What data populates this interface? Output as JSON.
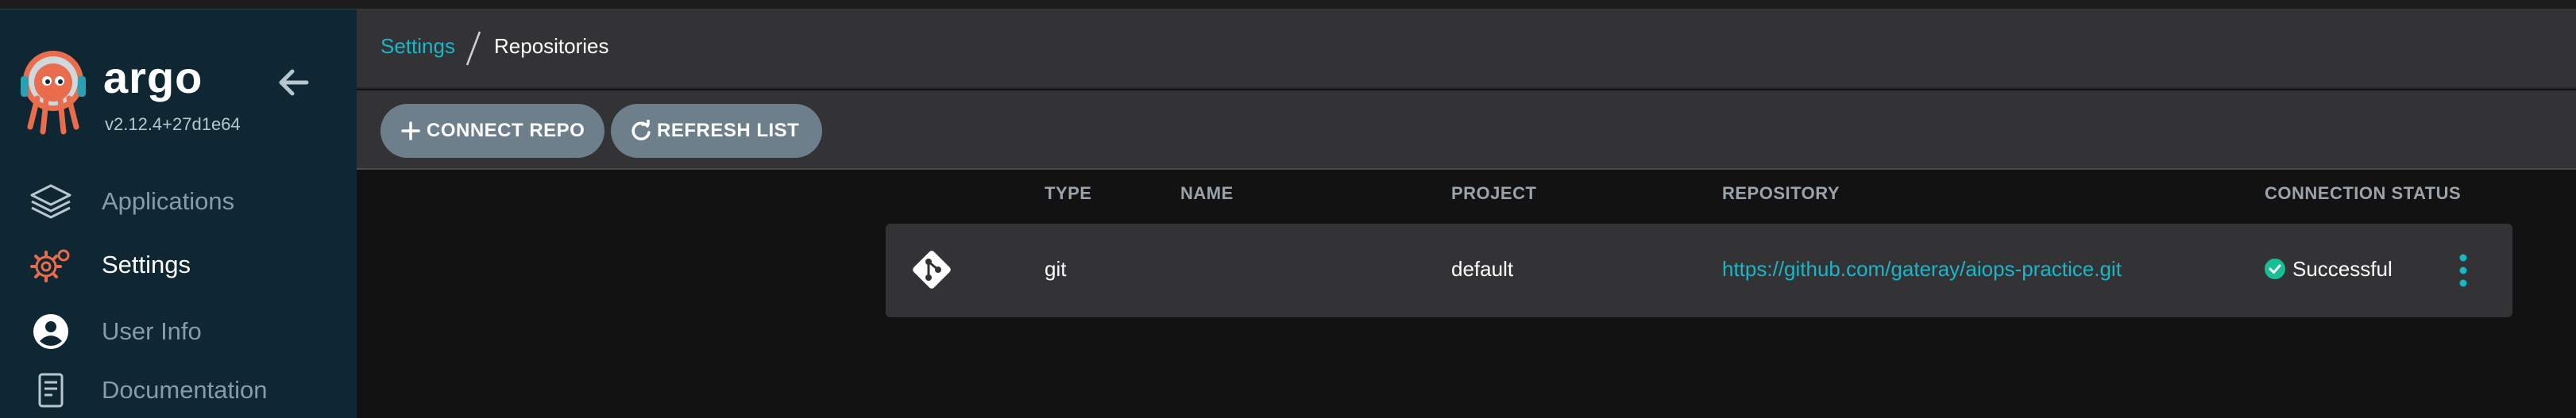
{
  "app": {
    "brand_name": "argo",
    "version": "v2.12.4+27d1e64"
  },
  "sidebar": {
    "items": [
      {
        "label": "Applications",
        "icon": "layers-icon",
        "active": false
      },
      {
        "label": "Settings",
        "icon": "gears-icon",
        "active": true
      },
      {
        "label": "User Info",
        "icon": "user-circle-icon",
        "active": false
      },
      {
        "label": "Documentation",
        "icon": "book-icon",
        "active": false
      }
    ]
  },
  "breadcrumb": {
    "parent": "Settings",
    "current": "Repositories"
  },
  "toolbar": {
    "connect_label": "CONNECT REPO",
    "connect_icon": "plus-icon",
    "refresh_label": "REFRESH LIST",
    "refresh_icon": "refresh-icon"
  },
  "table": {
    "columns": [
      "TYPE",
      "NAME",
      "PROJECT",
      "REPOSITORY",
      "CONNECTION STATUS"
    ],
    "rows": [
      {
        "icon": "git-icon",
        "type": "git",
        "name": "",
        "project": "default",
        "repository": "https://github.com/gateray/aiops-practice.git",
        "status": "Successful",
        "status_icon": "check-circle-icon"
      }
    ]
  },
  "colors": {
    "accent": "#18b6c9",
    "sidebar_bg": "#0f2733",
    "header_bg": "#333335",
    "button_bg": "#6e7f8c",
    "success": "#18be94",
    "logo_orange": "#e96d4c",
    "logo_teal": "#2b9fb3"
  }
}
